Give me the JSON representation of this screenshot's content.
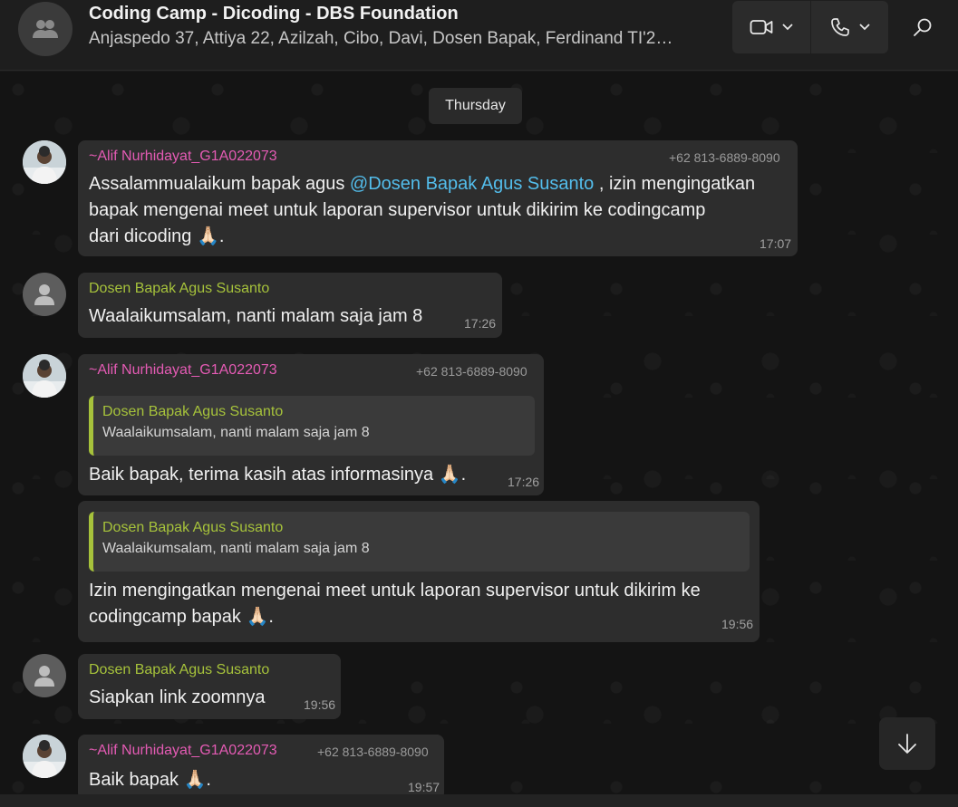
{
  "header": {
    "title": "Coding Camp - Dicoding - DBS Foundation",
    "members": "Anjaspedo 37, Attiya 22, Azilzah, Cibo, Davi, Dosen Bapak, Ferdinand TI'2…",
    "avatar_icon": "group-icon",
    "video_icon": "video-camera-icon",
    "phone_icon": "phone-icon",
    "search_icon": "search-icon"
  },
  "chat": {
    "day_separator": "Thursday",
    "messages": [
      {
        "sender": "~Alif Nurhidayat_G1A022073",
        "phone": "+62 813-6889-8090",
        "text_before": "Assalammualaikum bapak agus ",
        "mention": "@Dosen Bapak Agus Susanto",
        "text_line1_after": " , izin mengingatkan",
        "text_line2": "bapak mengenai meet untuk laporan supervisor untuk dikirim ke codingcamp",
        "text_line3": "dari dicoding 🙏🏻.",
        "time": "17:07"
      },
      {
        "sender": "Dosen Bapak Agus Susanto",
        "text": "Waalaikumsalam, nanti malam saja jam 8",
        "time": "17:26"
      },
      {
        "sender": "~Alif Nurhidayat_G1A022073",
        "phone": "+62 813-6889-8090",
        "quote_sender": "Dosen Bapak Agus Susanto",
        "quote_text": "Waalaikumsalam, nanti malam saja jam 8",
        "text": "Baik bapak, terima kasih atas informasinya 🙏🏻.",
        "time": "17:26"
      },
      {
        "quote_sender": "Dosen Bapak Agus Susanto",
        "quote_text": "Waalaikumsalam, nanti malam saja jam 8",
        "text_line1": "Izin mengingatkan mengenai meet untuk laporan supervisor untuk dikirim ke",
        "text_line2": "codingcamp bapak 🙏🏻.",
        "time": "19:56"
      },
      {
        "sender": "Dosen Bapak Agus Susanto",
        "text": "Siapkan link zoomnya",
        "time": "19:56"
      },
      {
        "sender": "~Alif Nurhidayat_G1A022073",
        "phone": "+62 813-6889-8090",
        "text": "Baik bapak 🙏🏻.",
        "time": "19:57"
      }
    ]
  },
  "scroll_icon": "arrow-down-icon",
  "colors": {
    "sender_pink": "#e45bb4",
    "sender_green": "#a6c23b",
    "mention_blue": "#53bdeb",
    "bubble": "#2d2d2d"
  }
}
